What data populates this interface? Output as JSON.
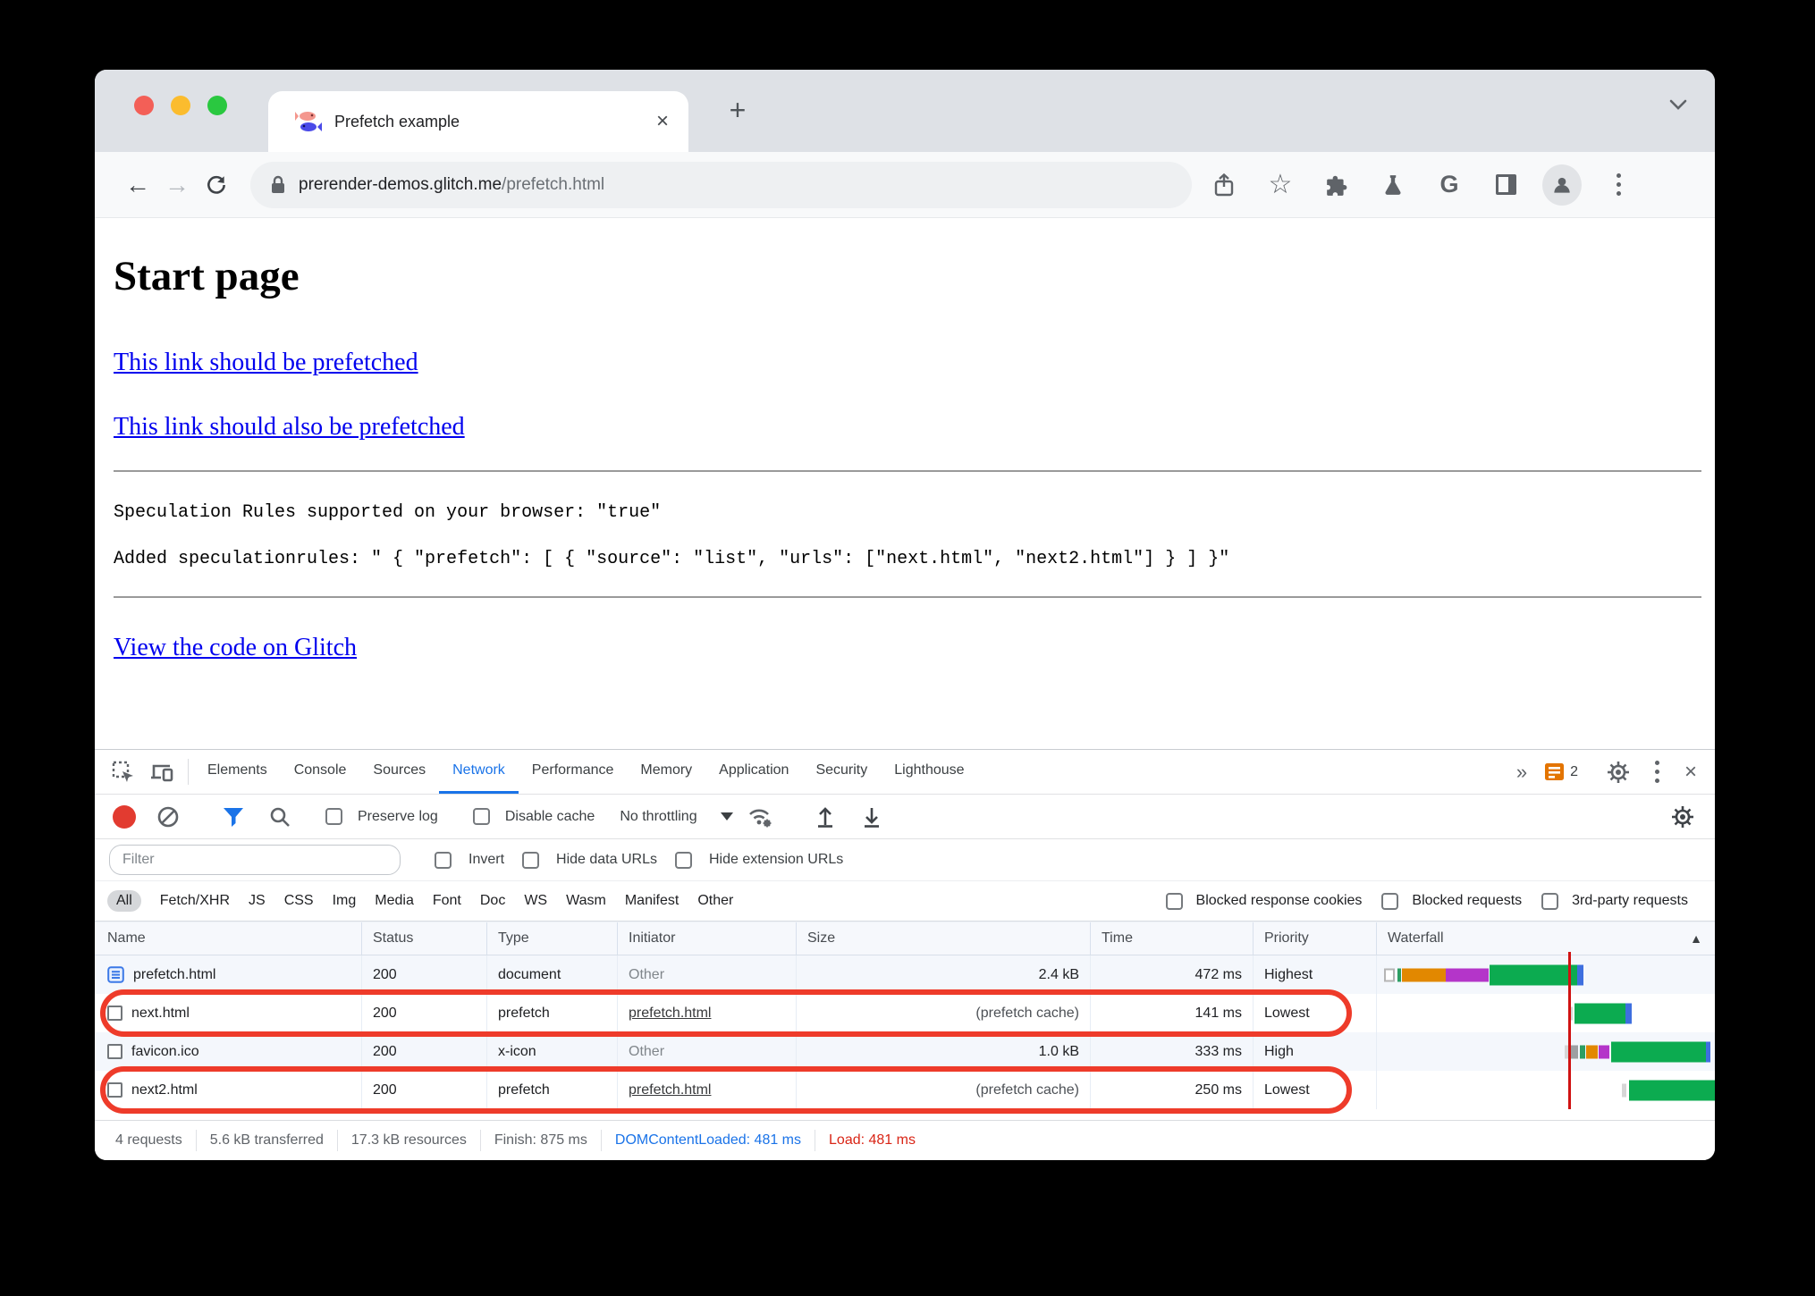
{
  "browser": {
    "tab_title": "Prefetch example",
    "tab_close": "×",
    "new_tab": "+",
    "url_host": "prerender-demos.glitch.me",
    "url_path": "/prefetch.html",
    "google_icon": "G"
  },
  "page": {
    "heading": "Start page",
    "link1": "This link should be prefetched",
    "link2": "This link should also be prefetched",
    "mono1": "Speculation Rules supported on your browser: \"true\"",
    "mono2": "Added speculationrules: \" { \"prefetch\": [ { \"source\": \"list\", \"urls\": [\"next.html\", \"next2.html\"] } ] }\"",
    "link3": "View the code on Glitch"
  },
  "devtools": {
    "tabs": [
      "Elements",
      "Console",
      "Sources",
      "Network",
      "Performance",
      "Memory",
      "Application",
      "Security",
      "Lighthouse"
    ],
    "more_tabs": "»",
    "issues_count": "2",
    "net_toolbar": {
      "preserve_log": "Preserve log",
      "disable_cache": "Disable cache",
      "throttling": "No throttling"
    },
    "filter": {
      "placeholder": "Filter",
      "invert": "Invert",
      "hide_data": "Hide data URLs",
      "hide_ext": "Hide extension URLs"
    },
    "chips": [
      "All",
      "Fetch/XHR",
      "JS",
      "CSS",
      "Img",
      "Media",
      "Font",
      "Doc",
      "WS",
      "Wasm",
      "Manifest",
      "Other"
    ],
    "chip_checks": [
      "Blocked response cookies",
      "Blocked requests",
      "3rd-party requests"
    ],
    "columns": [
      "Name",
      "Status",
      "Type",
      "Initiator",
      "Size",
      "Time",
      "Priority",
      "Waterfall"
    ],
    "sort_asc": "▲",
    "rows": [
      {
        "name": "prefetch.html",
        "status": "200",
        "type": "document",
        "initiator": "Other",
        "size": "2.4 kB",
        "time": "472 ms",
        "priority": "Highest"
      },
      {
        "name": "next.html",
        "status": "200",
        "type": "prefetch",
        "initiator": "prefetch.html",
        "size": "(prefetch cache)",
        "time": "141 ms",
        "priority": "Lowest"
      },
      {
        "name": "favicon.ico",
        "status": "200",
        "type": "x-icon",
        "initiator": "Other",
        "size": "1.0 kB",
        "time": "333 ms",
        "priority": "High"
      },
      {
        "name": "next2.html",
        "status": "200",
        "type": "prefetch",
        "initiator": "prefetch.html",
        "size": "(prefetch cache)",
        "time": "250 ms",
        "priority": "Lowest"
      }
    ],
    "summary": [
      "4 requests",
      "5.6 kB transferred",
      "17.3 kB resources",
      "Finish: 875 ms",
      "DOMContentLoaded: 481 ms",
      "Load: 481 ms"
    ]
  },
  "colors": {
    "accent_blue": "#1a73e8",
    "record_red": "#e23b30",
    "annotation_red": "#ee3b2a",
    "load_line_red": "#d01212",
    "waterfall_wait_green": "#0cab50",
    "waterfall_download_blue": "#3e6fdf",
    "waterfall_connect_orange": "#e28800",
    "waterfall_ssl_purple": "#b435c9"
  }
}
